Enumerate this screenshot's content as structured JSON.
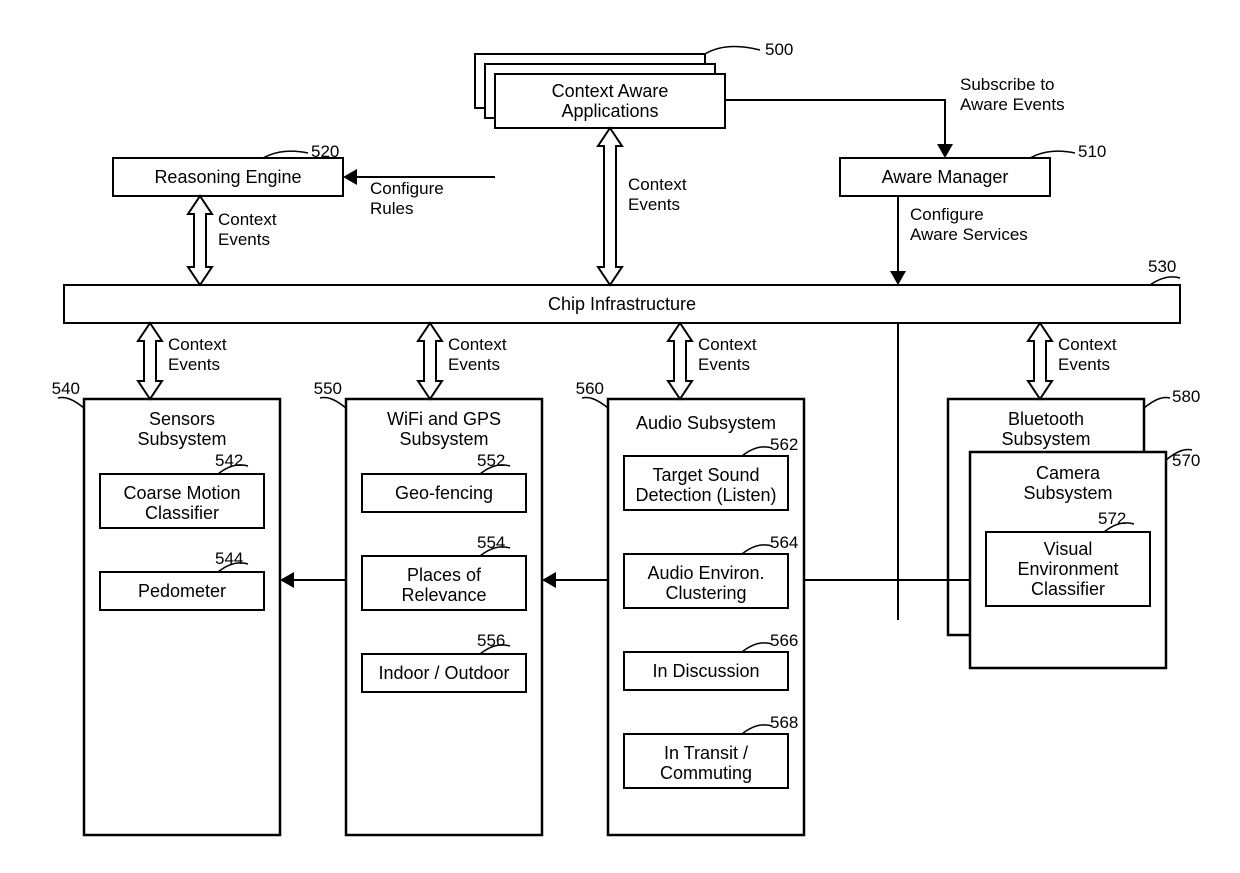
{
  "boxes": {
    "contextAwareApps": {
      "ref": "500",
      "line1": "Context Aware",
      "line2": "Applications"
    },
    "awareManager": {
      "ref": "510",
      "label": "Aware Manager"
    },
    "reasoningEngine": {
      "ref": "520",
      "label": "Reasoning Engine"
    },
    "chipInfra": {
      "ref": "530",
      "label": "Chip Infrastructure"
    },
    "sensors": {
      "ref": "540",
      "label": "Sensors Subsystem"
    },
    "coarseMotion": {
      "ref": "542",
      "line1": "Coarse Motion",
      "line2": "Classifier"
    },
    "pedometer": {
      "ref": "544",
      "label": "Pedometer"
    },
    "wifiGps": {
      "ref": "550",
      "line1": "WiFi and GPS",
      "line2": "Subsystem"
    },
    "geoFencing": {
      "ref": "552",
      "label": "Geo-fencing"
    },
    "placesRelevance": {
      "ref": "554",
      "line1": "Places of",
      "line2": "Relevance"
    },
    "indoorOutdoor": {
      "ref": "556",
      "label": "Indoor / Outdoor"
    },
    "audio": {
      "ref": "560",
      "label": "Audio Subsystem"
    },
    "targetSound": {
      "ref": "562",
      "line1": "Target Sound",
      "line2": "Detection (Listen)"
    },
    "audioEnviron": {
      "ref": "564",
      "line1": "Audio Environ.",
      "line2": "Clustering"
    },
    "inDiscussion": {
      "ref": "566",
      "label": "In Discussion"
    },
    "inTransit": {
      "ref": "568",
      "line1": "In Transit /",
      "line2": "Commuting"
    },
    "camera": {
      "ref": "570",
      "line1": "Camera",
      "line2": "Subsystem"
    },
    "visualEnv": {
      "ref": "572",
      "line1": "Visual",
      "line2": "Environment",
      "line3": "Classifier"
    },
    "bluetooth": {
      "ref": "580",
      "line1": "Bluetooth",
      "line2": "Subsystem"
    }
  },
  "edgeLabels": {
    "subscribe": {
      "line1": "Subscribe to",
      "line2": "Aware Events"
    },
    "configureRules": {
      "line1": "Configure",
      "line2": "Rules"
    },
    "contextEvents": {
      "line1": "Context",
      "line2": "Events"
    },
    "configureAware": {
      "line1": "Configure",
      "line2": "Aware Services"
    }
  }
}
